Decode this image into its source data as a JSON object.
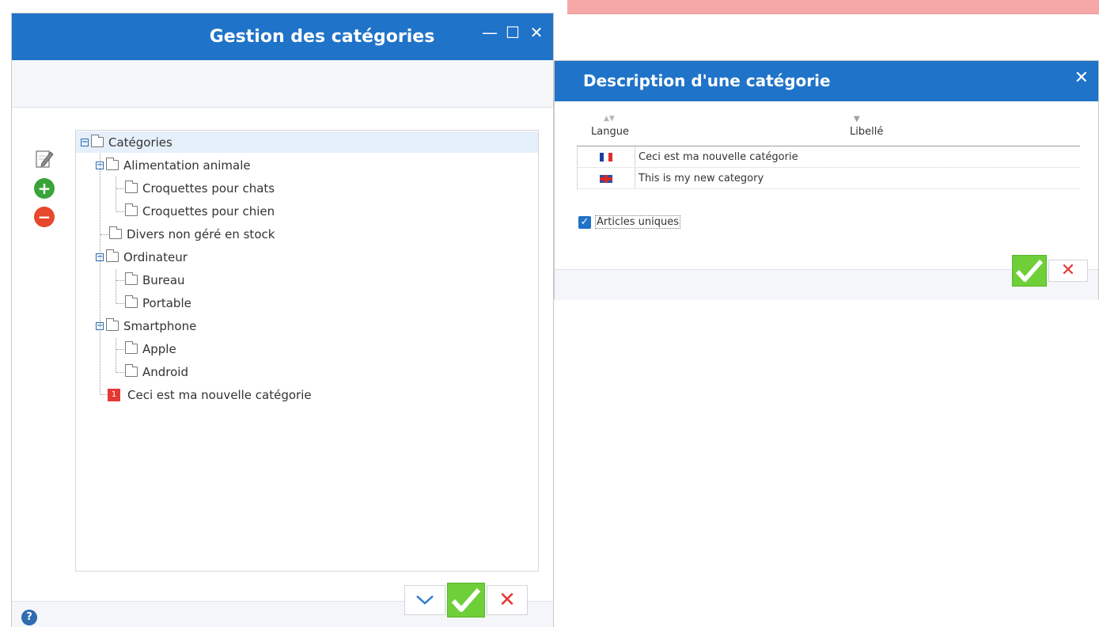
{
  "main_window": {
    "title": "Gestion des catégories",
    "controls": {
      "minimize": "—",
      "maximize": "☐",
      "close": "✕"
    },
    "tools": [
      {
        "name": "edit-icon"
      },
      {
        "name": "add-icon",
        "glyph": "+"
      },
      {
        "name": "remove-icon",
        "glyph": "−"
      }
    ],
    "tree": {
      "root": "Catégories",
      "items": {
        "alimentation": "Alimentation animale",
        "chats": "Croquettes pour chats",
        "chien": "Croquettes pour chien",
        "divers": "Divers non géré en stock",
        "ordinateur": "Ordinateur",
        "bureau": "Bureau",
        "portable": "Portable",
        "smartphone": "Smartphone",
        "apple": "Apple",
        "android": "Android",
        "nouvelle": "Ceci est ma nouvelle catégorie",
        "nouvelle_badge": "1"
      }
    },
    "help": "?",
    "buttons": {
      "down": "⌵",
      "ok": "✓",
      "cancel": "✕"
    }
  },
  "description_window": {
    "title": "Description d'une catégorie",
    "close": "✕",
    "columns": {
      "langue": "Langue",
      "libelle": "Libellé"
    },
    "rows": [
      {
        "flag": "fr-flag",
        "label": "Ceci est ma nouvelle catégorie"
      },
      {
        "flag": "uk-flag",
        "label": "This is my new category"
      }
    ],
    "checkbox": {
      "label": "Articles uniques",
      "checked": true,
      "mark": "✓"
    },
    "buttons": {
      "ok": "✓",
      "cancel": "✕"
    }
  },
  "colors": {
    "titlebar": "#1f73c8",
    "ok_green": "#6fcf39",
    "cancel_red": "#e53935",
    "new_badge": "#e53935"
  }
}
